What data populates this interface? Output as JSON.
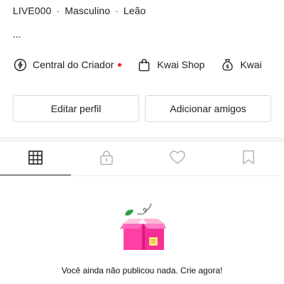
{
  "profile": {
    "id": "LIVE000",
    "gender": "Masculino",
    "sign": "Leão",
    "separator": "·",
    "bio": "..."
  },
  "shortcuts": [
    {
      "label": "Central do Criador",
      "icon": "lightning-circle-icon",
      "has_dot": true
    },
    {
      "label": "Kwai Shop",
      "icon": "shopping-bag-icon"
    },
    {
      "label": "Kwai",
      "icon": "money-bag-icon"
    }
  ],
  "actions": {
    "edit_label": "Editar perfil",
    "add_label": "Adicionar amigos"
  },
  "tabs": [
    {
      "name": "grid",
      "icon": "grid-icon",
      "active": true
    },
    {
      "name": "private",
      "icon": "lock-icon",
      "active": false
    },
    {
      "name": "likes",
      "icon": "heart-icon",
      "active": false
    },
    {
      "name": "saved",
      "icon": "bookmark-icon",
      "active": false
    }
  ],
  "empty_state": {
    "icon": "empty-box-icon",
    "message": "Você ainda não publicou nada. Crie agora!"
  },
  "colors": {
    "notification_dot": "#e0202e",
    "box_pink": "#ff3fa4",
    "leaf_green": "#34a853"
  }
}
